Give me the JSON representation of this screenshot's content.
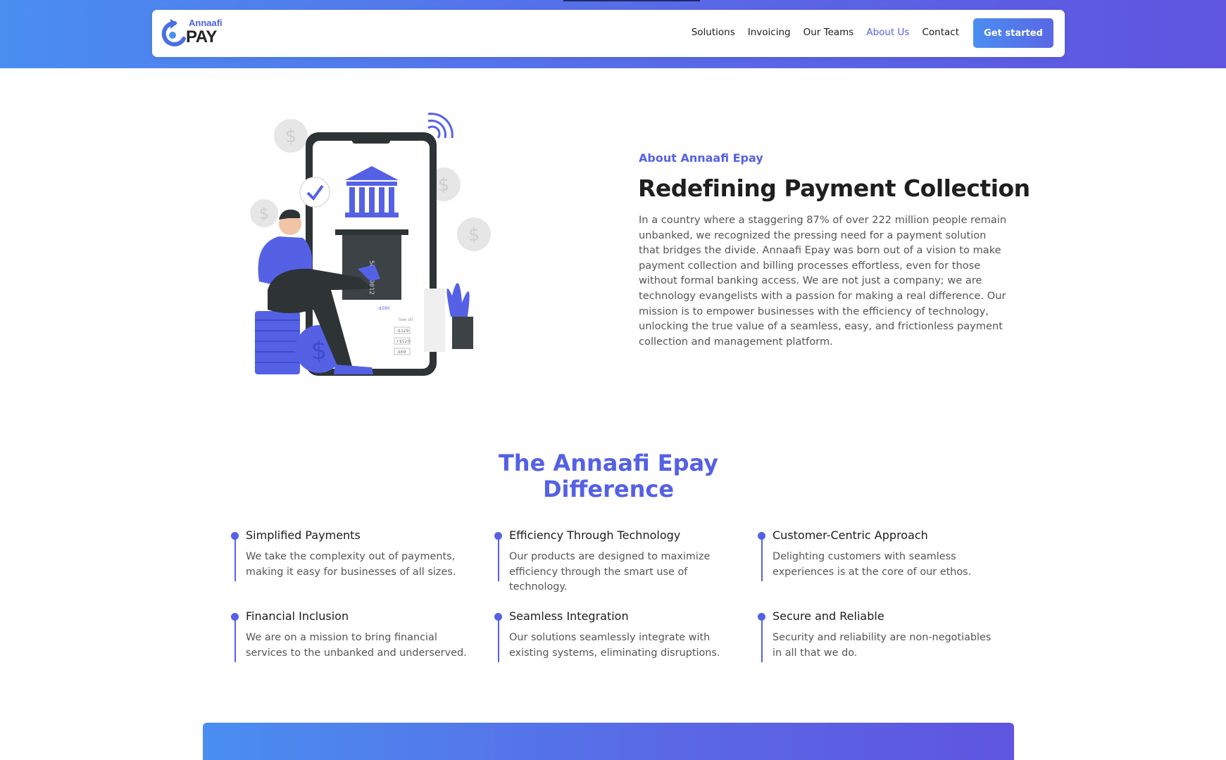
{
  "nav": {
    "logo_top": "Annaafi",
    "logo_bottom": "PAY",
    "links": [
      "Solutions",
      "Invoicing",
      "Our Teams",
      "About Us",
      "Contact"
    ],
    "cta": "Get started"
  },
  "about": {
    "eyebrow": "About Annaafi Epay",
    "title": "Redefining Payment Collection",
    "body": "In a country where a staggering 87% of over 222 million people remain unbanked, we recognized the pressing need for a payment solution that bridges the divide. Annaafi Epay was born out of a vision to make payment collection and billing processes effortless, even for those without formal banking access. We are not just a company; we are technology evangelists with a passion for making a real difference. Our mission is to empower businesses with the efficiency of technology, unlocking the true value of a seamless, easy, and frictionless payment collection and management platform."
  },
  "illustration": {
    "card_number": "5678 9012",
    "amounts": [
      "-$590",
      "See all",
      "-$129",
      "+$520",
      "-$69"
    ]
  },
  "difference": {
    "title_line1": "The Annaafi Epay",
    "title_line2": "Difference",
    "items": [
      {
        "title": "Simplified Payments",
        "desc": "We take the complexity out of payments, making it easy for businesses of all sizes."
      },
      {
        "title": "Efficiency Through Technology",
        "desc": "Our products are designed to maximize efficiency through the smart use of technology."
      },
      {
        "title": "Customer-Centric Approach",
        "desc": "Delighting customers with seamless experiences is at the core of our ethos."
      },
      {
        "title": "Financial Inclusion",
        "desc": "We are on a mission to bring financial services to the unbanked and underserved."
      },
      {
        "title": "Seamless Integration",
        "desc": "Our solutions seamlessly integrate with existing systems, eliminating disruptions."
      },
      {
        "title": "Secure and Reliable",
        "desc": "Security and reliability are non-negotiables in all that we do."
      }
    ]
  },
  "colors": {
    "accent": "#5561e4",
    "gradient_start": "#4a8ef0",
    "gradient_end": "#5f55e0"
  }
}
